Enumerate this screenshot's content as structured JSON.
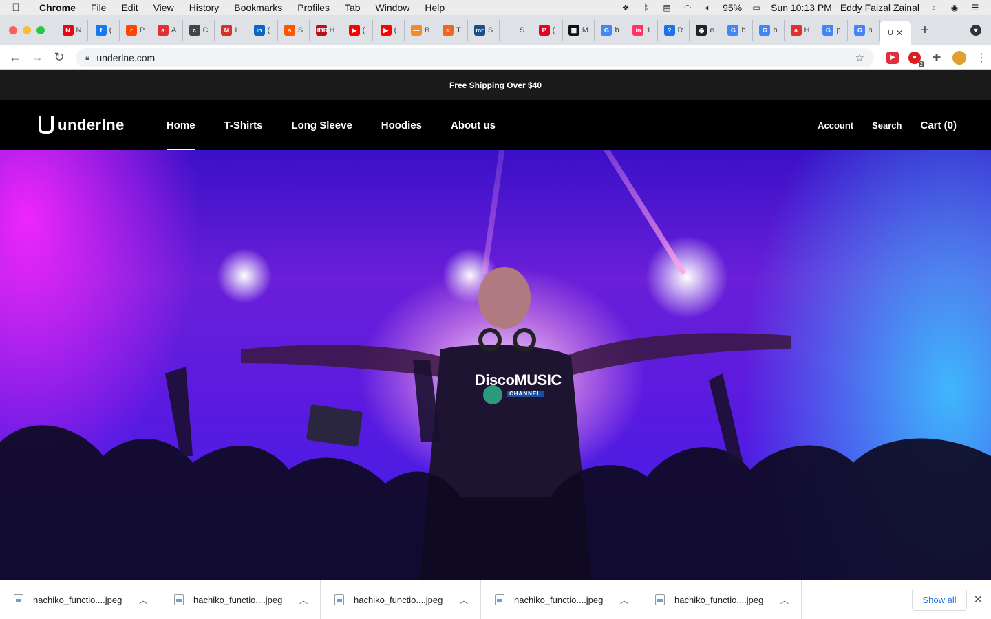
{
  "menubar": {
    "app": "Chrome",
    "items": [
      "File",
      "Edit",
      "View",
      "History",
      "Bookmarks",
      "Profiles",
      "Tab",
      "Window",
      "Help"
    ],
    "battery": "95%",
    "clock": "Sun 10:13 PM",
    "user": "Eddy Faizal Zainal"
  },
  "tabs": [
    {
      "letter": "N",
      "fav": "N",
      "color": "#e50914"
    },
    {
      "letter": "(",
      "fav": "f",
      "color": "#1877f2"
    },
    {
      "letter": "P",
      "fav": "r",
      "color": "#ff4500"
    },
    {
      "letter": "A",
      "fav": "a",
      "color": "#e03030"
    },
    {
      "letter": "C",
      "fav": "c",
      "color": "#444444"
    },
    {
      "letter": "L",
      "fav": "M",
      "color": "#d93025"
    },
    {
      "letter": "(",
      "fav": "in",
      "color": "#0a66c2"
    },
    {
      "letter": "S",
      "fav": "s",
      "color": "#ff5500"
    },
    {
      "letter": "H",
      "fav": "HBR",
      "color": "#b4121b"
    },
    {
      "letter": "(",
      "fav": "▶",
      "color": "#ff0000"
    },
    {
      "letter": "(",
      "fav": "▶",
      "color": "#ff0000"
    },
    {
      "letter": "B",
      "fav": "—",
      "color": "#f28c28"
    },
    {
      "letter": "T",
      "fav": "≈",
      "color": "#f26522"
    },
    {
      "letter": "S",
      "fav": "mr",
      "color": "#1d4e89"
    },
    {
      "letter": "S",
      "fav": "",
      "color": "#dee1e6"
    },
    {
      "letter": "(",
      "fav": "P",
      "color": "#e60023"
    },
    {
      "letter": "M",
      "fav": "▦",
      "color": "#111111"
    },
    {
      "letter": "b",
      "fav": "G",
      "color": "#4285f4"
    },
    {
      "letter": "1",
      "fav": "in",
      "color": "#ff3366"
    },
    {
      "letter": "R",
      "fav": "?",
      "color": "#1a73e8"
    },
    {
      "letter": "e",
      "fav": "◉",
      "color": "#222222"
    },
    {
      "letter": "b",
      "fav": "G",
      "color": "#4285f4"
    },
    {
      "letter": "h",
      "fav": "G",
      "color": "#4285f4"
    },
    {
      "letter": "H",
      "fav": "a",
      "color": "#e03030"
    },
    {
      "letter": "p",
      "fav": "G",
      "color": "#4285f4"
    },
    {
      "letter": "n",
      "fav": "G",
      "color": "#4285f4"
    }
  ],
  "active_tab": {
    "letter": "U",
    "close": "✕"
  },
  "address": {
    "url": "underlne.com"
  },
  "site": {
    "announcement": "Free Shipping Over $40",
    "logo_text": "underlne",
    "nav": [
      "Home",
      "T-Shirts",
      "Long Sleeve",
      "Hoodies",
      "About us"
    ],
    "account": "Account",
    "search": "Search",
    "cart": "Cart (0)"
  },
  "hero": {
    "shirt_logo": "DiscoMUSIC",
    "shirt_sub": "CHANNEL"
  },
  "downloads": {
    "files": [
      "hachiko_functio....jpeg",
      "hachiko_functio....jpeg",
      "hachiko_functio....jpeg",
      "hachiko_functio....jpeg",
      "hachiko_functio....jpeg"
    ],
    "show_all": "Show all"
  },
  "colors": {
    "close": "#ff5f57",
    "minimize": "#febc2e",
    "zoom": "#28c840"
  }
}
